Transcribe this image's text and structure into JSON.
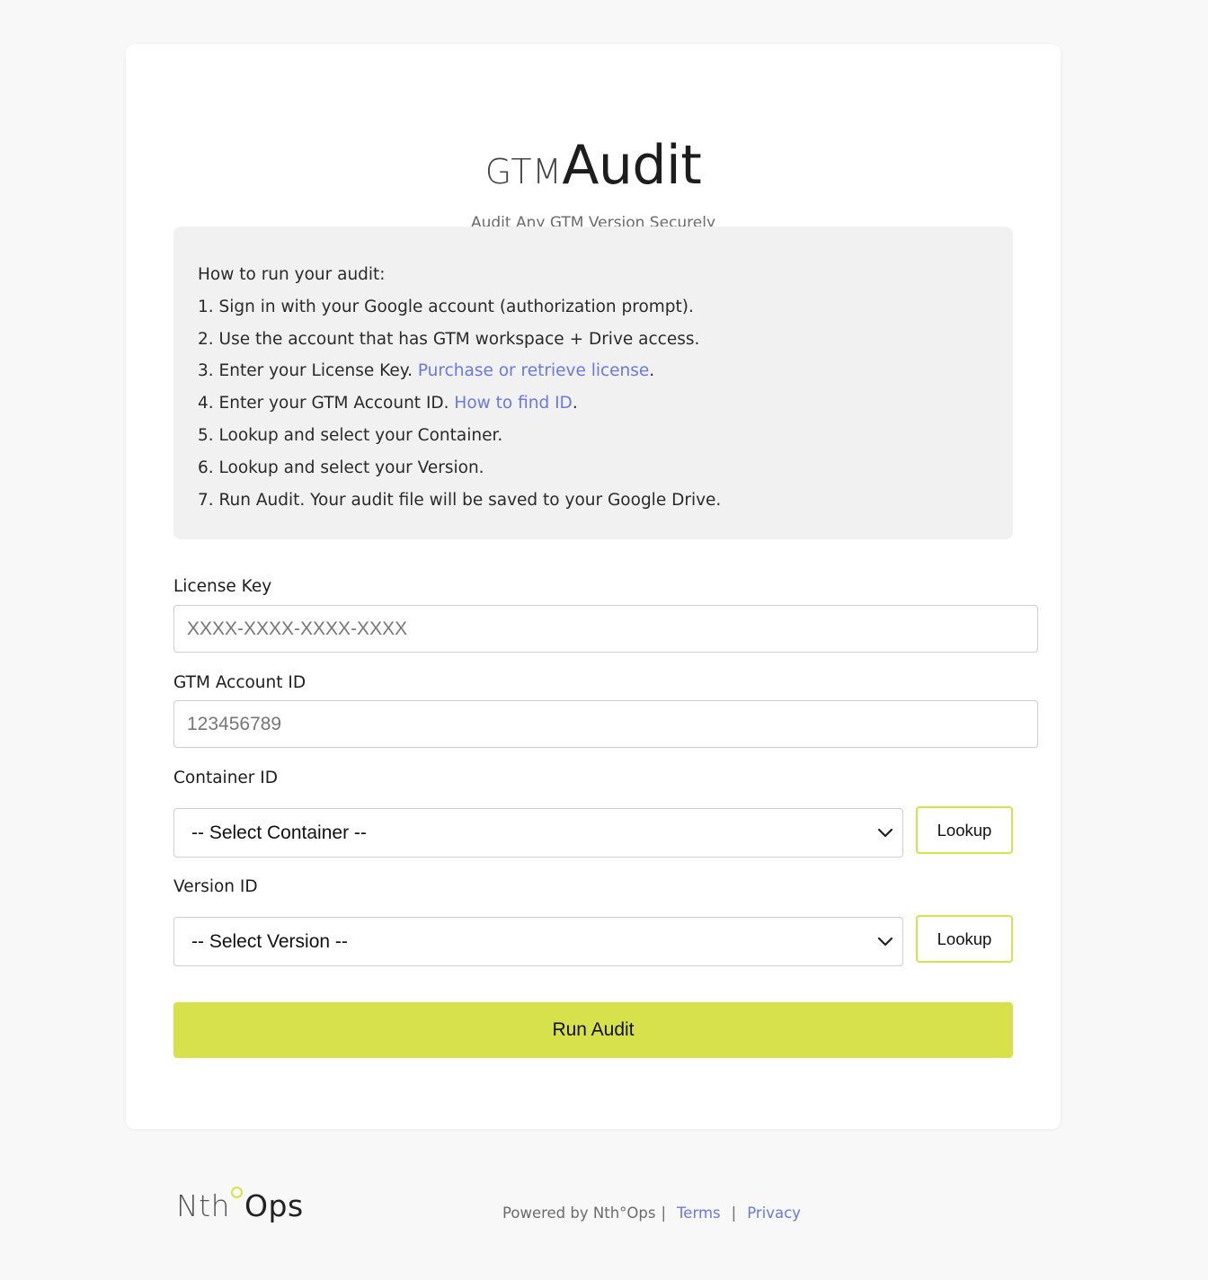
{
  "header": {
    "logo_prefix": "GTM",
    "logo_main": "Audit",
    "tagline": "Audit Any GTM Version Securely"
  },
  "instructions": {
    "heading": "How to run your audit:",
    "steps": [
      {
        "text": "1. Sign in with your Google account (authorization prompt)."
      },
      {
        "text": "2. Use the account that has GTM workspace + Drive access."
      },
      {
        "text": "3. Enter your License Key. ",
        "link": "Purchase or retrieve license",
        "after": "."
      },
      {
        "text": "4. Enter your GTM Account ID. ",
        "link": "How to find ID",
        "after": "."
      },
      {
        "text": "5. Lookup and select your Container."
      },
      {
        "text": "6. Lookup and select your Version."
      },
      {
        "text": "7. Run Audit. Your audit file will be saved to your Google Drive."
      }
    ]
  },
  "form": {
    "license_key": {
      "label": "License Key",
      "placeholder": "XXXX-XXXX-XXXX-XXXX",
      "value": ""
    },
    "account_id": {
      "label": "GTM Account ID",
      "placeholder": "123456789",
      "value": ""
    },
    "container": {
      "label": "Container ID",
      "selected": "-- Select Container --",
      "lookup_label": "Lookup"
    },
    "version": {
      "label": "Version ID",
      "selected": "-- Select Version --",
      "lookup_label": "Lookup"
    },
    "run_label": "Run Audit"
  },
  "footer": {
    "logo_left": "Nth",
    "logo_right": "Ops",
    "powered_by": "Powered by Nth°Ops",
    "sep": "|",
    "terms": "Terms",
    "privacy": "Privacy"
  },
  "colors": {
    "accent": "#d7e14b",
    "link": "#6a78e6",
    "background": "#f8f8f8",
    "card": "#ffffff",
    "instructions_bg": "#f1f1f1"
  },
  "icons": {
    "select_arrow": "chevron-down-icon",
    "logo_degree": "circle-icon"
  }
}
